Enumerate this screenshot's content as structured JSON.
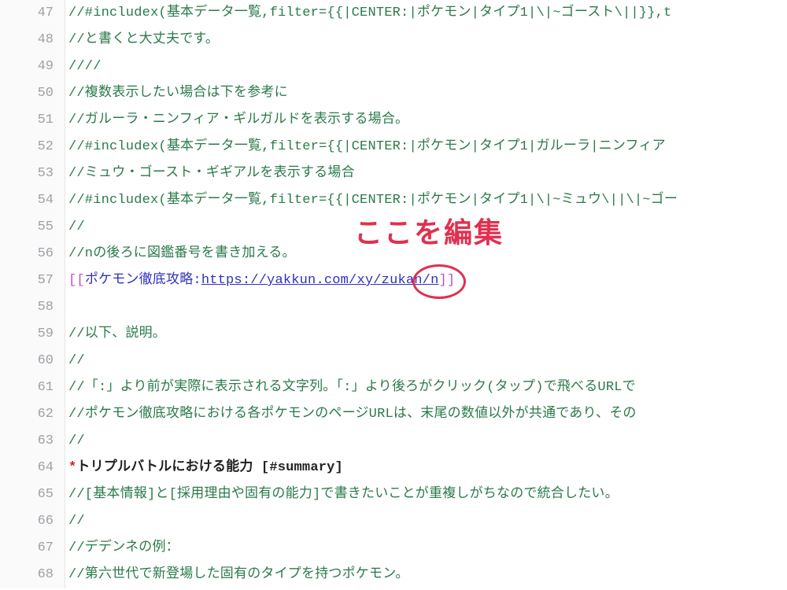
{
  "annotation": {
    "label": "ここを編集"
  },
  "lines": [
    {
      "n": 47,
      "kind": "comment",
      "text": "//#includex(基本データ一覧,filter={{|CENTER:|ポケモン|タイプ1|\\|~ゴースト\\||}},t"
    },
    {
      "n": 48,
      "kind": "comment",
      "text": "//と書くと大丈夫です。"
    },
    {
      "n": 49,
      "kind": "comment",
      "text": "////"
    },
    {
      "n": 50,
      "kind": "comment",
      "text": "//複数表示したい場合は下を参考に"
    },
    {
      "n": 51,
      "kind": "comment",
      "text": "//ガルーラ・ニンフィア・ギルガルドを表示する場合。"
    },
    {
      "n": 52,
      "kind": "comment",
      "text": "//#includex(基本データ一覧,filter={{|CENTER:|ポケモン|タイプ1|ガルーラ|ニンフィア"
    },
    {
      "n": 53,
      "kind": "comment",
      "text": "//ミュウ・ゴースト・ギギアルを表示する場合"
    },
    {
      "n": 54,
      "kind": "comment",
      "text": "//#includex(基本データ一覧,filter={{|CENTER:|ポケモン|タイプ1|\\|~ミュウ\\||\\|~ゴー"
    },
    {
      "n": 55,
      "kind": "comment",
      "text": "//"
    },
    {
      "n": 56,
      "kind": "comment",
      "text": "//nの後ろに図鑑番号を書き加える。"
    },
    {
      "n": 57,
      "kind": "link",
      "open": "[[",
      "label": "ポケモン徹底攻略",
      "sep": ":",
      "url": "https://yakkun.com/xy/zukan/n",
      "close": "]]"
    },
    {
      "n": 58,
      "kind": "blank",
      "text": ""
    },
    {
      "n": 59,
      "kind": "comment",
      "text": "//以下、説明。"
    },
    {
      "n": 60,
      "kind": "comment",
      "text": "//"
    },
    {
      "n": 61,
      "kind": "comment",
      "text": "//「:」より前が実際に表示される文字列。「:」より後ろがクリック(タップ)で飛べるURLで"
    },
    {
      "n": 62,
      "kind": "comment",
      "text": "//ポケモン徹底攻略における各ポケモンのページURLは、末尾の数値以外が共通であり、その"
    },
    {
      "n": 63,
      "kind": "comment",
      "text": "//"
    },
    {
      "n": 64,
      "kind": "heading",
      "star": "*",
      "text": "トリプルバトルにおける能力 [#summary]"
    },
    {
      "n": 65,
      "kind": "comment",
      "text": "//[基本情報]と[採用理由や固有の能力]で書きたいことが重複しがちなので統合したい。"
    },
    {
      "n": 66,
      "kind": "comment",
      "text": "//"
    },
    {
      "n": 67,
      "kind": "comment",
      "text": "//デデンネの例："
    },
    {
      "n": 68,
      "kind": "comment",
      "text": "//第六世代で新登場した固有のタイプを持つポケモン。"
    }
  ]
}
